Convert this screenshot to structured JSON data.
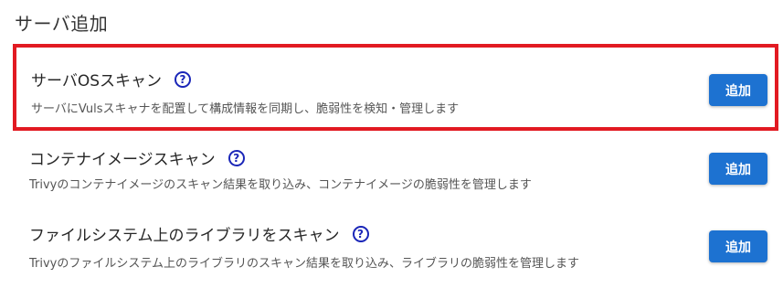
{
  "page": {
    "title": "サーバ追加"
  },
  "options": [
    {
      "title": "サーバOSスキャン",
      "description": "サーバにVulsスキャナを配置して構成情報を同期し、脆弱性を検知・管理します",
      "button_label": "追加",
      "highlighted": true
    },
    {
      "title": "コンテナイメージスキャン",
      "description": "Trivyのコンテナイメージのスキャン結果を取り込み、コンテナイメージの脆弱性を管理します",
      "button_label": "追加",
      "highlighted": false
    },
    {
      "title": "ファイルシステム上のライブラリをスキャン",
      "description": "Trivyのファイルシステム上のライブラリのスキャン結果を取り込み、ライブラリの脆弱性を管理します",
      "button_label": "追加",
      "highlighted": false
    }
  ],
  "icons": {
    "help": "help-circle-icon",
    "help_glyph": "?"
  },
  "colors": {
    "highlight_border": "#e21a22",
    "button": "#1d72d1",
    "help_icon": "#1a26b8"
  }
}
